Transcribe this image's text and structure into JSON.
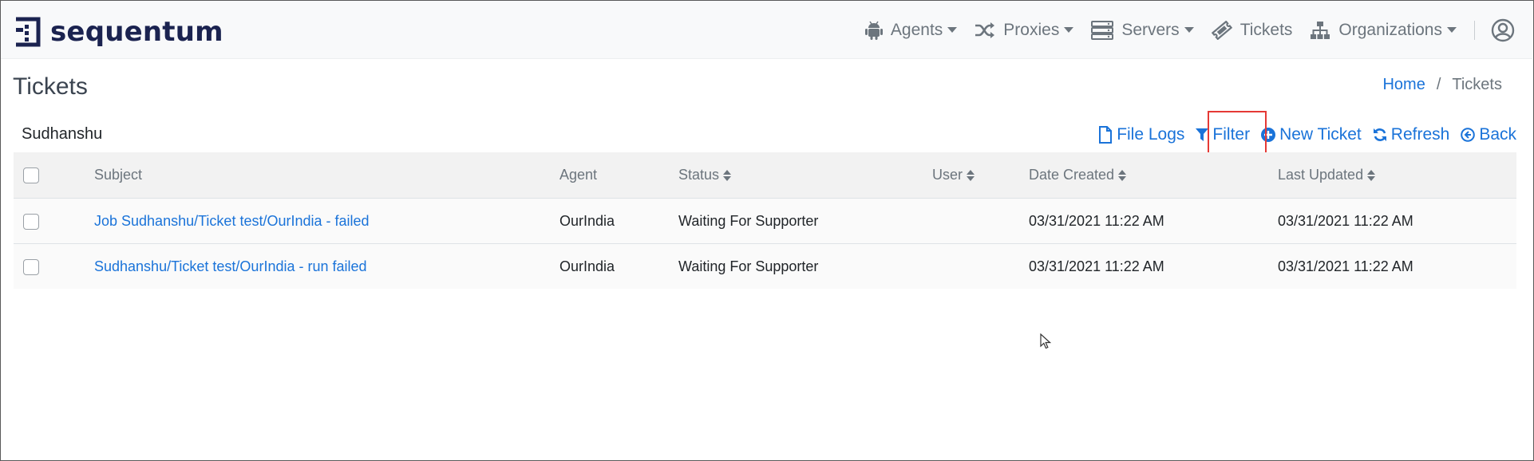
{
  "brand": {
    "name": "sequentum"
  },
  "nav": {
    "agents": "Agents",
    "proxies": "Proxies",
    "servers": "Servers",
    "tickets": "Tickets",
    "organizations": "Organizations"
  },
  "page": {
    "title": "Tickets"
  },
  "breadcrumb": {
    "home": "Home",
    "separator": "/",
    "current": "Tickets"
  },
  "toolbar": {
    "org_name": "Sudhanshu",
    "file_logs": "File Logs",
    "filter": "Filter",
    "new_ticket": "New Ticket",
    "refresh": "Refresh",
    "back": "Back"
  },
  "table": {
    "headers": {
      "subject": "Subject",
      "agent": "Agent",
      "status": "Status",
      "user": "User",
      "date_created": "Date Created",
      "last_updated": "Last Updated"
    },
    "rows": [
      {
        "subject": "Job Sudhanshu/Ticket test/OurIndia - failed",
        "agent": "OurIndia",
        "status": "Waiting For Supporter",
        "user": "",
        "date_created": "03/31/2021 11:22 AM",
        "last_updated": "03/31/2021 11:22 AM"
      },
      {
        "subject": "Sudhanshu/Ticket test/OurIndia - run failed",
        "agent": "OurIndia",
        "status": "Waiting For Supporter",
        "user": "",
        "date_created": "03/31/2021 11:22 AM",
        "last_updated": "03/31/2021 11:22 AM"
      }
    ]
  },
  "colors": {
    "brand_navy": "#1b2350",
    "link_blue": "#1a73d9",
    "muted_gray": "#6c757d",
    "highlight_red": "#e53935"
  }
}
